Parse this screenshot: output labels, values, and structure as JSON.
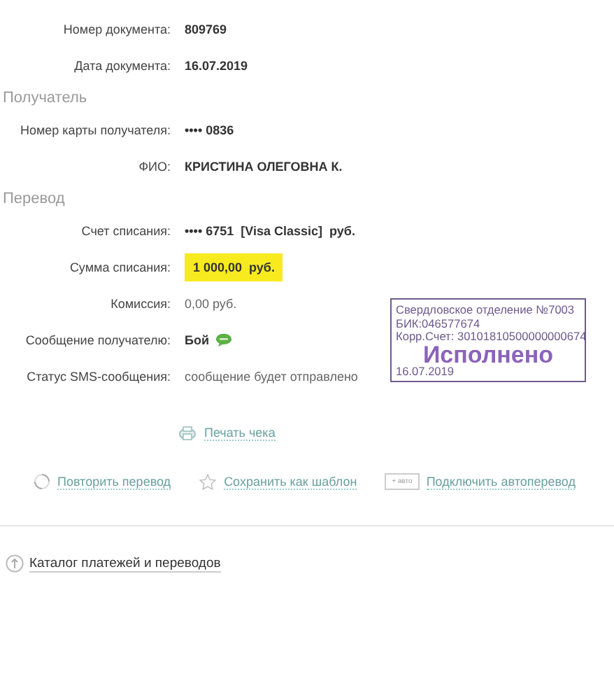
{
  "document": [
    {
      "label": "Номер документа:",
      "value": "809769",
      "kind": "bold"
    },
    {
      "label": "Дата документа:",
      "value": "16.07.2019",
      "kind": "bold"
    }
  ],
  "sections": [
    {
      "title": "Получатель",
      "rows": [
        {
          "label": "Номер карты получателя:",
          "value": "•••• 0836",
          "kind": "bold"
        },
        {
          "label": "ФИО:",
          "value": "КРИСТИНА ОЛЕГОВНА К.",
          "kind": "bold"
        }
      ]
    },
    {
      "title": "Перевод",
      "rows": [
        {
          "label": "Счет списания:",
          "value": "•••• 6751  [Visa Classic]  руб.",
          "kind": "bold"
        },
        {
          "label": "Сумма списания:",
          "value": "1 000,00  руб.",
          "kind": "highlight"
        },
        {
          "label": "Комиссия:",
          "value": "0,00 руб.",
          "kind": "plain"
        },
        {
          "label": "Сообщение получателю:",
          "value": "Бой",
          "kind": "message"
        },
        {
          "label": "Статус SMS-сообщения:",
          "value": "сообщение будет отправлено",
          "kind": "plain"
        }
      ]
    }
  ],
  "stamp": {
    "lines": [
      "Свердловское отделение №7003",
      "БИК:046577674",
      "Корр.Счет: 30101810500000000674"
    ],
    "status": "Исполнено",
    "date": "16.07.2019"
  },
  "print_link": "Печать чека",
  "actions": [
    {
      "kind": "repeat",
      "label": "Повторить перевод"
    },
    {
      "kind": "template",
      "label": "Сохранить как шаблон"
    },
    {
      "kind": "auto",
      "label": "Подключить автоперевод",
      "badge": "+ авто"
    }
  ],
  "catalog_link": "Каталог платежей и переводов"
}
